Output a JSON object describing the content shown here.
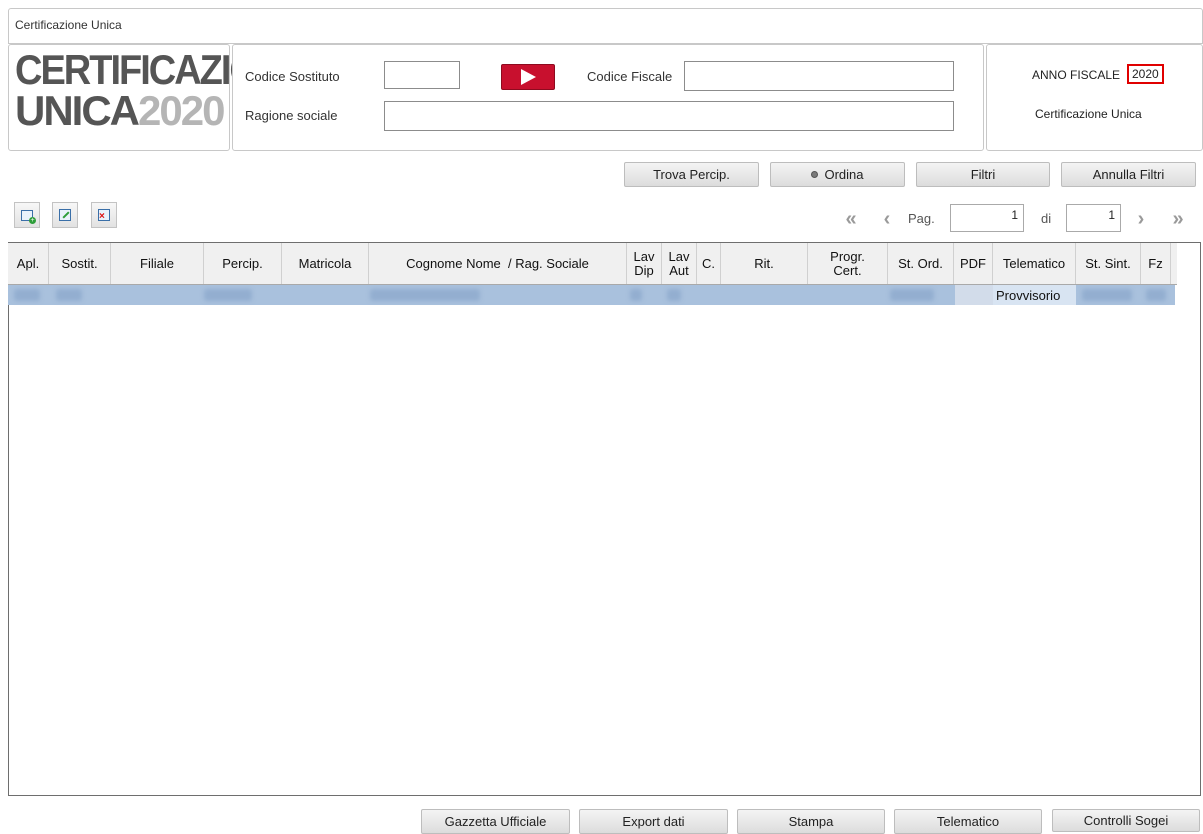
{
  "window": {
    "title": "Certificazione Unica"
  },
  "logo": {
    "line1": "CERTIFICAZIONE",
    "line2a": "UNICA",
    "line2b": "2020"
  },
  "form": {
    "codice_sostituto_label": "Codice Sostituto",
    "codice_sostituto_value": "",
    "codice_fiscale_label": "Codice Fiscale",
    "codice_fiscale_value": "",
    "ragione_sociale_label": "Ragione sociale",
    "ragione_sociale_value": ""
  },
  "anno": {
    "label": "ANNO FISCALE",
    "value": "2020",
    "subtitle": "Certificazione Unica"
  },
  "toolbar": {
    "trova": "Trova Percip.",
    "ordina": "Ordina",
    "filtri": "Filtri",
    "annulla": "Annulla Filtri"
  },
  "pager": {
    "pag_label": "Pag.",
    "page": "1",
    "di_label": "di",
    "total": "1"
  },
  "table": {
    "columns": [
      "Apl.",
      "Sostit.",
      "Filiale",
      "Percip.",
      "Matricola",
      "Cognome Nome  / Rag. Sociale",
      "Lav Dip",
      "Lav Aut",
      "C.",
      "Rit.",
      "Progr. Cert.",
      "St. Ord.",
      "PDF",
      "Telematico",
      "St. Sint.",
      "Fz"
    ],
    "rows": [
      {
        "telematico": "Provvisorio"
      }
    ]
  },
  "footer": {
    "gazzetta": "Gazzetta Ufficiale",
    "export": "Export dati",
    "stampa": "Stampa",
    "telematico": "Telematico",
    "controlli": "Controlli Sogei"
  },
  "colors": {
    "selected_row": "#a9c1dd",
    "play_button": "#c8102e",
    "highlight_border": "#e00000"
  }
}
